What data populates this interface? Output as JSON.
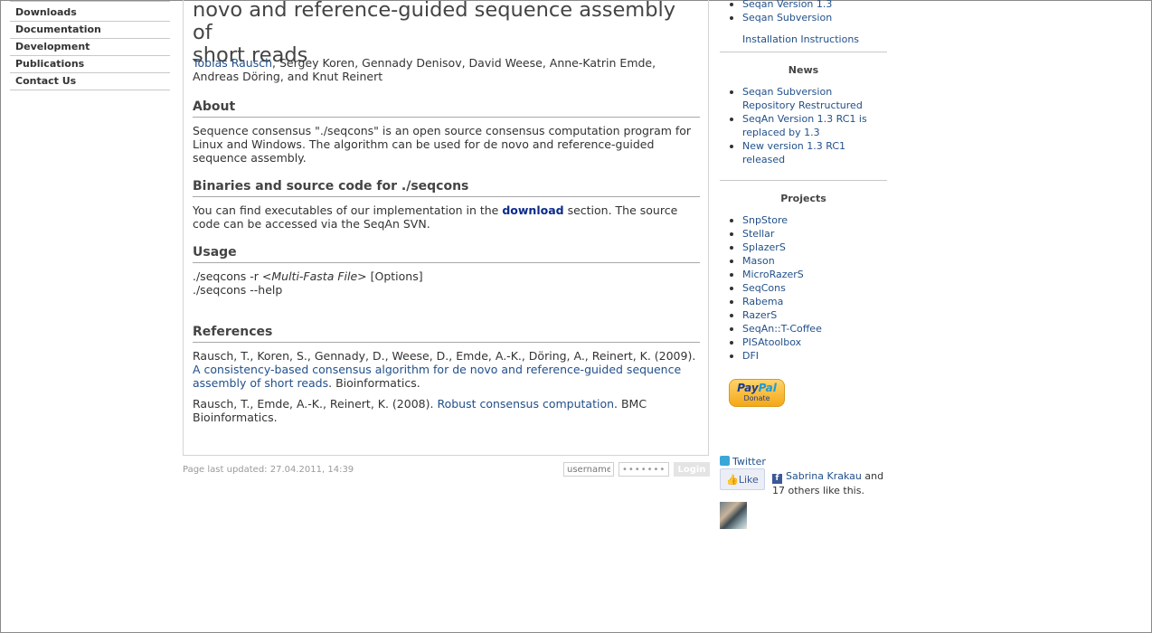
{
  "nav": {
    "items": [
      {
        "label": "Downloads"
      },
      {
        "label": "Documentation"
      },
      {
        "label": "Development"
      },
      {
        "label": "Publications"
      },
      {
        "label": "Contact Us"
      }
    ]
  },
  "article": {
    "title_line1": "novo and reference-guided sequence assembly of",
    "title_line2": "short reads",
    "author_link": "Tobias Rausch",
    "authors_rest": ", Sergey Koren, Gennady Denisov, David Weese, Anne-Katrin Emde, Andreas Döring, and Knut Reinert",
    "about_heading": "About",
    "about_text": "Sequence consensus \"./seqcons\" is an open source consensus computation program for Linux and Windows. The algorithm can be used for de novo and reference-guided sequence assembly.",
    "binaries_heading": "Binaries and source code for ./seqcons",
    "binaries_text_before": "You can find executables of our implementation in the ",
    "binaries_link": "download",
    "binaries_text_after": " section. The source code can be accessed via the SeqAn SVN.",
    "usage_heading": "Usage",
    "usage_line1_prefix": "./seqcons -r <",
    "usage_line1_italic": "Multi-Fasta File",
    "usage_line1_suffix": "> [Options]",
    "usage_line2": "./seqcons --help",
    "references_heading": "References",
    "ref1_prefix": "Rausch, T., Koren, S., Gennady, D., Weese, D., Emde, A.-K., Döring, A., Reinert, K. (2009). ",
    "ref1_link": "A consistency-based consensus algorithm for de novo and reference-guided sequence assembly of short reads",
    "ref1_suffix": ". Bioinformatics.",
    "ref2_prefix": "Rausch, T., Emde, A.-K., Reinert, K. (2008). ",
    "ref2_link": "Robust consensus computation",
    "ref2_suffix": ". BMC Bioinformatics."
  },
  "footer": {
    "updated": "Page last updated: 27.04.2011, 14:39",
    "username_placeholder": "username",
    "password_value": "••••••••",
    "login_label": "Login"
  },
  "sidebar": {
    "top_links": [
      {
        "label": "Seqan Version 1.3"
      },
      {
        "label": "Seqan Subversion"
      }
    ],
    "install_link": "Installation Instructions",
    "news_heading": "News",
    "news": [
      {
        "label": "Seqan Subversion Repository Restructured"
      },
      {
        "label": "SeqAn Version 1.3 RC1 is replaced by 1.3"
      },
      {
        "label": "New version 1.3 RC1 released"
      }
    ],
    "projects_heading": "Projects",
    "projects": [
      {
        "label": "SnpStore"
      },
      {
        "label": "Stellar"
      },
      {
        "label": "SplazerS"
      },
      {
        "label": "Mason"
      },
      {
        "label": "MicroRazerS"
      },
      {
        "label": "SeqCons"
      },
      {
        "label": "Rabema"
      },
      {
        "label": "RazerS"
      },
      {
        "label": "SeqAn::T-Coffee"
      },
      {
        "label": "PISAtoolbox"
      },
      {
        "label": "DFI"
      }
    ],
    "paypal_pay": "Pay",
    "paypal_pal": "Pal",
    "paypal_donate": "Donate",
    "twitter": "Twitter",
    "like_label": "Like",
    "fb_link": "Sabrina Krakau",
    "fb_rest": " and 17 others like this.",
    "colors": {
      "link": "#22508a",
      "facebook": "#3b5998",
      "paypal": "#f4a817"
    }
  }
}
